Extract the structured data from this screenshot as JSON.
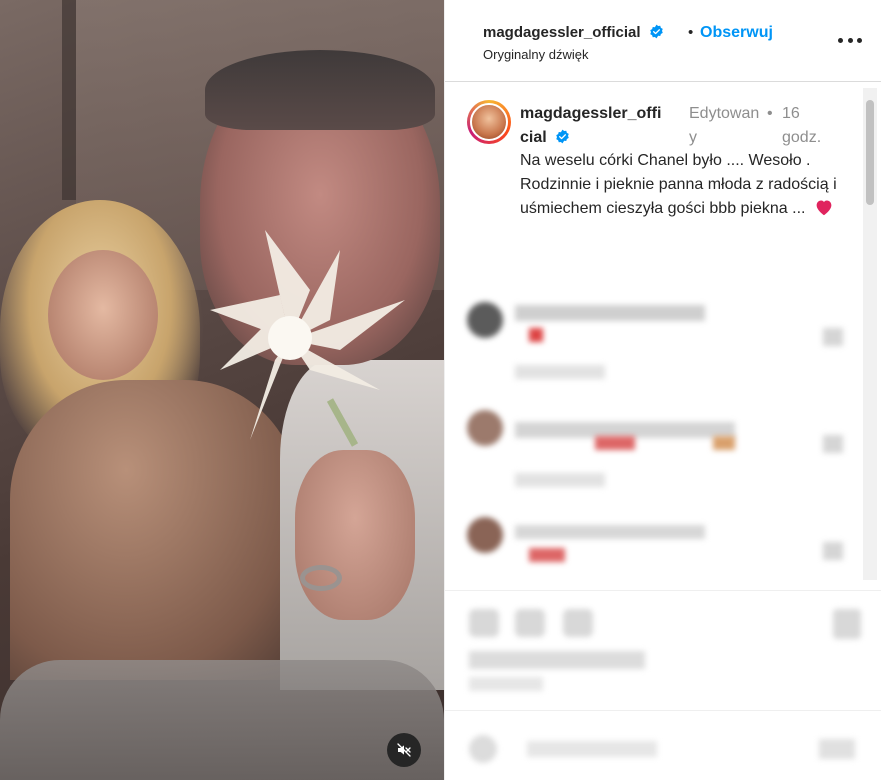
{
  "post": {
    "username": "magdagessler_official",
    "follow_label": "Obserwuj",
    "audio_label": "Oryginalny dźwięk",
    "more_icon": "more-horizontal-icon",
    "verified_icon": "verified-badge-icon"
  },
  "caption": {
    "username_wrapped": "magdagessler_official",
    "edited_label": "Edytowany",
    "time_label": "16 godz.",
    "text": "Na weselu córki Chanel było .... Wesoło . Rodzinnie i pieknie panna młoda z radością i uśmiechem cieszyła gości bbb piekna ...",
    "emoji_icon": "red-heart-icon"
  },
  "media": {
    "mute_icon": "speaker-muted-icon"
  },
  "colors": {
    "accent": "#0095f6",
    "verified": "#0095f6",
    "heart": "#e0245e",
    "text": "#262626",
    "muted": "#8e8e8e"
  }
}
